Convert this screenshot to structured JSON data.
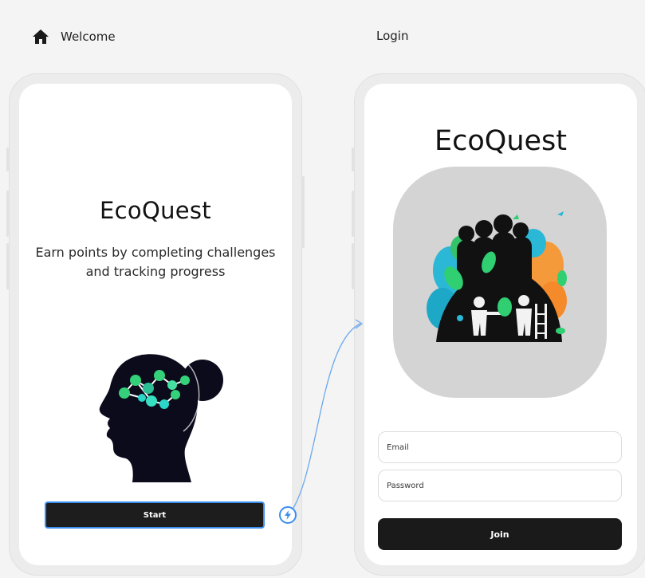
{
  "frames": {
    "welcome": {
      "label": "Welcome",
      "title": "EcoQuest",
      "subtitle": "Earn points by completing challenges and tracking progress",
      "start_label": "Start"
    },
    "login": {
      "label": "Login",
      "title": "EcoQuest",
      "email_placeholder": "Email",
      "password_placeholder": "Password",
      "join_label": "Join"
    }
  },
  "icons": {
    "home": "home-icon",
    "trigger": "lightning-icon"
  },
  "colors": {
    "accent": "#3b8ef0",
    "button": "#1d1d1d",
    "canvas": "#f4f4f4",
    "logo_bg": "#d4d4d4"
  }
}
